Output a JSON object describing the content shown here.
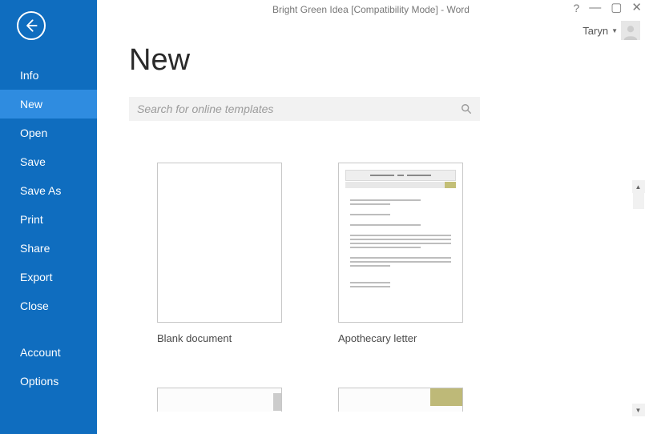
{
  "window": {
    "title": "Bright Green Idea [Compatibility Mode] - Word"
  },
  "account": {
    "name": "Taryn"
  },
  "sidebar": {
    "items": [
      {
        "label": "Info"
      },
      {
        "label": "New"
      },
      {
        "label": "Open"
      },
      {
        "label": "Save"
      },
      {
        "label": "Save As"
      },
      {
        "label": "Print"
      },
      {
        "label": "Share"
      },
      {
        "label": "Export"
      },
      {
        "label": "Close"
      }
    ],
    "bottom": [
      {
        "label": "Account"
      },
      {
        "label": "Options"
      }
    ],
    "active_label": "New"
  },
  "page": {
    "heading": "New",
    "search_placeholder": "Search for online templates"
  },
  "templates": [
    {
      "label": "Blank document"
    },
    {
      "label": "Apothecary letter"
    }
  ]
}
